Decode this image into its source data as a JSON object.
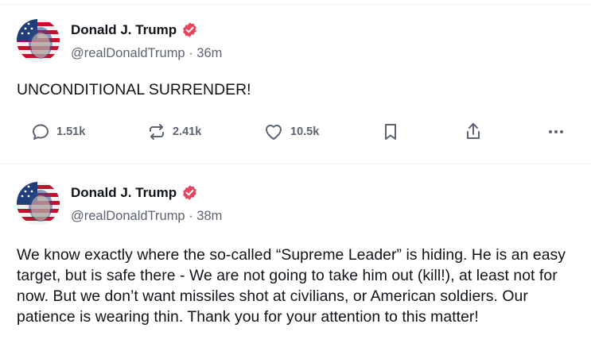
{
  "posts": [
    {
      "author_name": "Donald J. Trump",
      "handle_time": "@realDonaldTrump · 36m",
      "text": "UNCONDITIONAL SURRENDER!",
      "replies": "1.51k",
      "reposts": "2.41k",
      "likes": "10.5k"
    },
    {
      "author_name": "Donald J. Trump",
      "handle_time": "@realDonaldTrump · 38m",
      "text": "We know exactly where the so-called “Supreme Leader” is hiding. He is an easy target, but is safe there - We are not going to take him out (kill!), at least not for now. But we don’t want missiles shot at civilians, or American soldiers. Our patience is wearing thin. Thank you for your attention to this matter!"
    }
  ],
  "icons": {
    "verified": "verified-badge-icon",
    "reply": "speech-bubble-icon",
    "repost": "repost-arrows-icon",
    "like": "heart-icon",
    "bookmark": "bookmark-icon",
    "share": "share-upload-icon",
    "more": "more-dots-icon"
  },
  "colors": {
    "verified_badge": "#e8445e",
    "muted_text": "#5b6470",
    "divider": "#eceef1"
  }
}
